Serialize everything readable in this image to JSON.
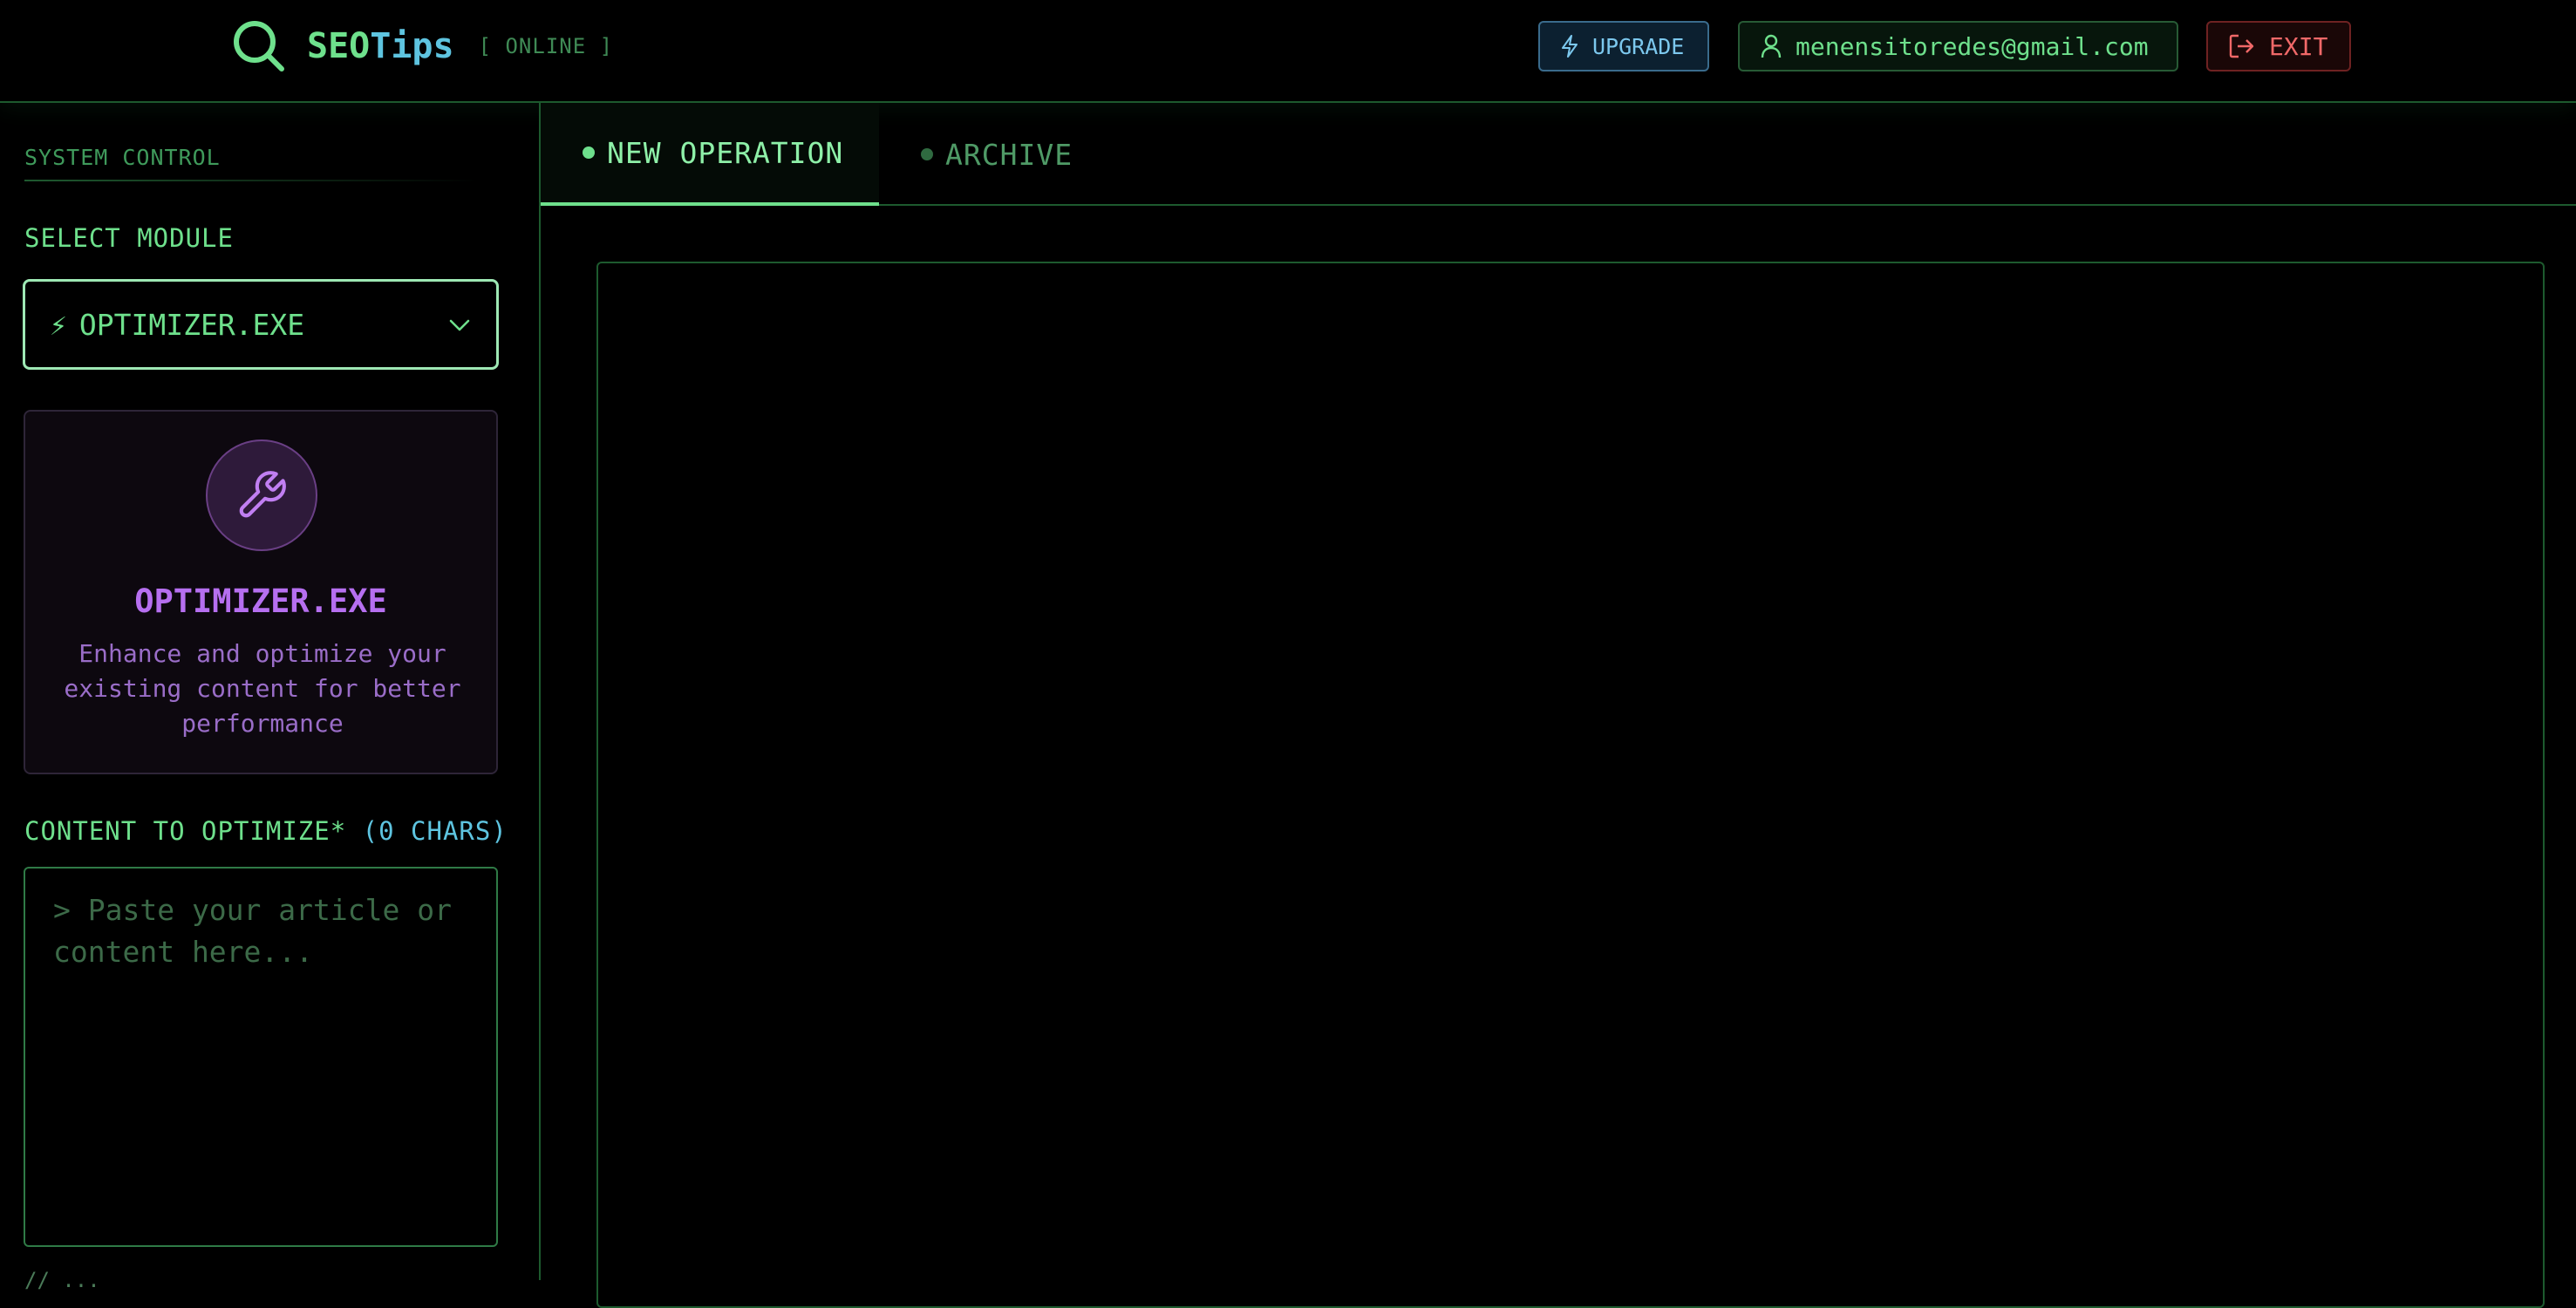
{
  "header": {
    "brand_part1": "SEO",
    "brand_part2": "Tips",
    "status": "[ ONLINE ]",
    "upgrade_label": "UPGRADE",
    "user_email": "menensitoredes@gmail.com",
    "exit_label": "EXIT"
  },
  "sidebar": {
    "section_title": "SYSTEM CONTROL",
    "select_module_label": "SELECT MODULE",
    "selected_module": "OPTIMIZER.EXE",
    "selected_module_icon": "lightning-icon",
    "module_card": {
      "icon": "wrench-icon",
      "title": "OPTIMIZER.EXE",
      "description": "Enhance and optimize your existing content for better performance"
    },
    "content_label": "CONTENT TO OPTIMIZE*",
    "char_count": "(0 CHARS)",
    "content_value": "",
    "content_placeholder": "> Paste your article or content here..."
  },
  "tabs": [
    {
      "label": "NEW OPERATION",
      "active": true
    },
    {
      "label": "ARCHIVE",
      "active": false
    }
  ],
  "colors": {
    "accent_green": "#6ee08c",
    "accent_cyan": "#5ec4e0",
    "accent_purple": "#b66ff0",
    "danger_red": "#f06868",
    "background": "#000000"
  }
}
